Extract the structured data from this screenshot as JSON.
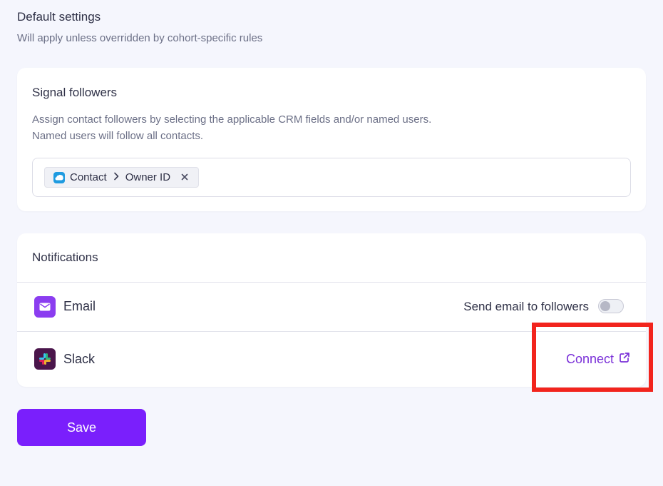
{
  "header": {
    "title": "Default settings",
    "subtitle": "Will apply unless overridden by cohort-specific rules"
  },
  "signal_followers": {
    "title": "Signal followers",
    "description_line1": "Assign contact followers by selecting the applicable CRM fields and/or named users.",
    "description_line2": "Named users will follow all contacts.",
    "chip": {
      "icon": "salesforce-icon",
      "object": "Contact",
      "separator_icon": "chevron-right-icon",
      "field": "Owner ID",
      "remove_icon": "close-icon"
    }
  },
  "notifications": {
    "title": "Notifications",
    "email": {
      "icon": "email-icon",
      "label": "Email",
      "toggle_label": "Send email to followers",
      "toggle_on": false
    },
    "slack": {
      "icon": "slack-icon",
      "label": "Slack",
      "connect_label": "Connect",
      "connect_icon": "external-link-icon"
    }
  },
  "actions": {
    "save_label": "Save"
  },
  "colors": {
    "accent": "#7a1ffc",
    "link": "#7a30d8",
    "highlight": "#f2241d",
    "background": "#f5f6fd"
  }
}
